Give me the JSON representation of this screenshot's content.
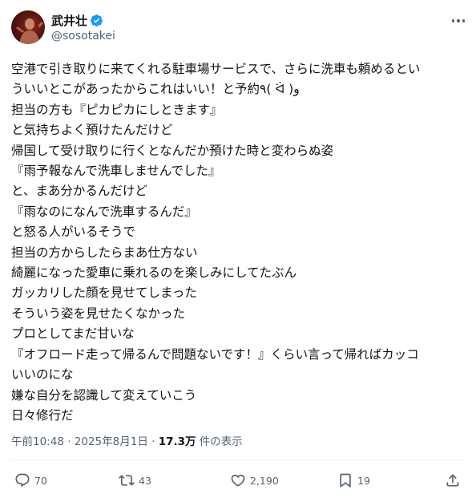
{
  "author": {
    "display_name": "武井壮",
    "handle": "@sosotakei",
    "verified": true
  },
  "tweet_lines": [
    "空港で引き取りに来てくれる駐車場サービスで、さらに洗車も頼めるとい",
    "ういいとこがあったからこれはいい！と予約٩( ᐛ )و",
    "担当の方も『ピカピカにしときます』",
    "と気持ちよく預けたんだけど",
    "帰国して受け取りに行くとなんだか預けた時と変わらぬ姿",
    "『雨予報なんで洗車しませんでした』",
    "と、まあ分かるんだけど",
    "『雨なのになんで洗車するんだ』",
    "と怒る人がいるそうで",
    "担当の方からしたらまあ仕方ない",
    "綺麗になった愛車に乗れるのを楽しみにしてたぶん",
    "ガッカリした顔を見せてしまった",
    "そういう姿を見せたくなかった",
    "プロとしてまだ甘いな",
    "『オフロード走って帰るんで問題ないです！』くらい言って帰ればカッコ",
    "いいのにな",
    "嫌な自分を認識して変えていこう",
    "日々修行だ"
  ],
  "meta": {
    "time": "午前10:48",
    "separator": " · ",
    "date": "2025年8月1日",
    "views_count": "17.3万",
    "views_label": " 件の表示"
  },
  "actions": {
    "replies": "70",
    "reposts": "43",
    "likes": "2,190",
    "bookmarks": "19"
  },
  "colors": {
    "text": "#0f1419",
    "secondary": "#536471",
    "verified": "#1d9bf0",
    "divider": "#eff3f4"
  }
}
